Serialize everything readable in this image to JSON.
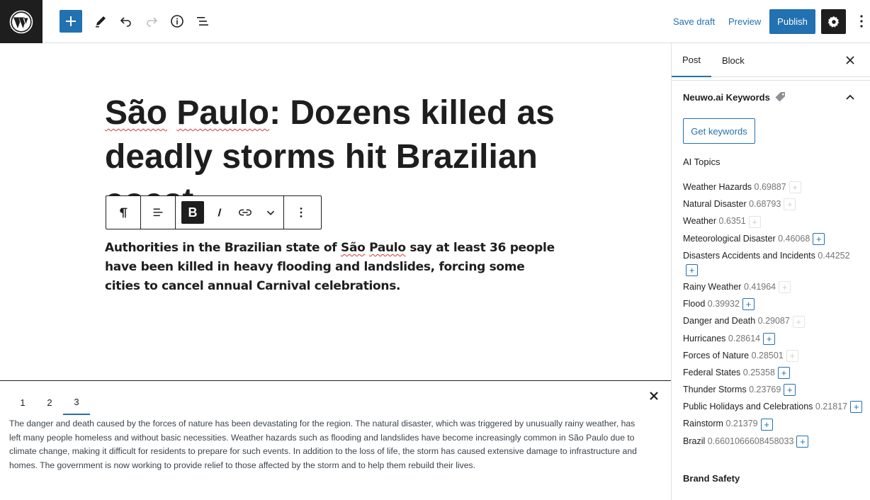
{
  "header": {
    "save_draft": "Save draft",
    "preview": "Preview",
    "publish": "Publish"
  },
  "post": {
    "title_part1": "São",
    "title_part2": "Paulo",
    "title_rest": ": Dozens killed as deadly storms hit Brazilian coast",
    "paragraph_before": "Authorities in the Brazilian state of ",
    "paragraph_spell1": "São",
    "paragraph_space": " ",
    "paragraph_spell2": "Paulo",
    "paragraph_after": " say at least 36 people have been killed in heavy flooding and landslides, forcing some cities to cancel annual Carnival celebrations."
  },
  "bottom_panel": {
    "tabs": [
      "1",
      "2",
      "3"
    ],
    "active_tab": "3",
    "text": "The danger and death caused by the forces of nature has been devastating for the region. The natural disaster, which was triggered by unusually rainy weather, has left many people homeless and without basic necessities. Weather hazards such as flooding and landslides have become increasingly common in São Paulo due to climate change, making it difficult for residents to prepare for such events. In addition to the loss of life, the storm has caused extensive damage to infrastructure and homes. The government is now working to provide relief to those affected by the storm and to help them rebuild their lives."
  },
  "sidebar": {
    "tabs": [
      "Post",
      "Block"
    ],
    "panel_title": "Neuwo.ai Keywords",
    "get_keywords": "Get keywords",
    "ai_topics_label": "AI Topics",
    "topics": [
      {
        "name": "Weather Hazards",
        "score": "0.69887",
        "added": true
      },
      {
        "name": "Natural Disaster",
        "score": "0.68793",
        "added": true
      },
      {
        "name": "Weather",
        "score": "0.6351",
        "added": true
      },
      {
        "name": "Meteorological Disaster",
        "score": "0.46068",
        "added": false
      },
      {
        "name": "Disasters Accidents and Incidents",
        "score": "0.44252",
        "added": false
      },
      {
        "name": "Rainy Weather",
        "score": "0.41964",
        "added": true
      },
      {
        "name": "Flood",
        "score": "0.39932",
        "added": false
      },
      {
        "name": "Danger and Death",
        "score": "0.29087",
        "added": true
      },
      {
        "name": "Hurricanes",
        "score": "0.28614",
        "added": false
      },
      {
        "name": "Forces of Nature",
        "score": "0.28501",
        "added": true
      },
      {
        "name": "Federal States",
        "score": "0.25358",
        "added": false
      },
      {
        "name": "Thunder Storms",
        "score": "0.23769",
        "added": false
      },
      {
        "name": "Public Holidays and Celebrations",
        "score": "0.21817",
        "added": false
      },
      {
        "name": "Rainstorm",
        "score": "0.21379",
        "added": false
      },
      {
        "name": "Brazil",
        "score": "0.6601066608458033",
        "added": false
      }
    ],
    "plus_symbol": "+",
    "brand_safety": "Brand Safety"
  },
  "icons": {
    "wp_logo": "wordpress-logo",
    "add": "plus-icon",
    "edit": "pencil-icon",
    "undo": "undo-icon",
    "redo": "redo-icon",
    "info": "info-icon",
    "list_view": "list-view-icon",
    "settings": "gear-icon",
    "more": "more-vertical-icon",
    "close": "close-icon",
    "tag": "tag-icon",
    "chevron_up": "chevron-up-icon"
  },
  "colors": {
    "accent": "#2271b1",
    "dark": "#1e1e1e",
    "spell_error": "#d63638"
  }
}
